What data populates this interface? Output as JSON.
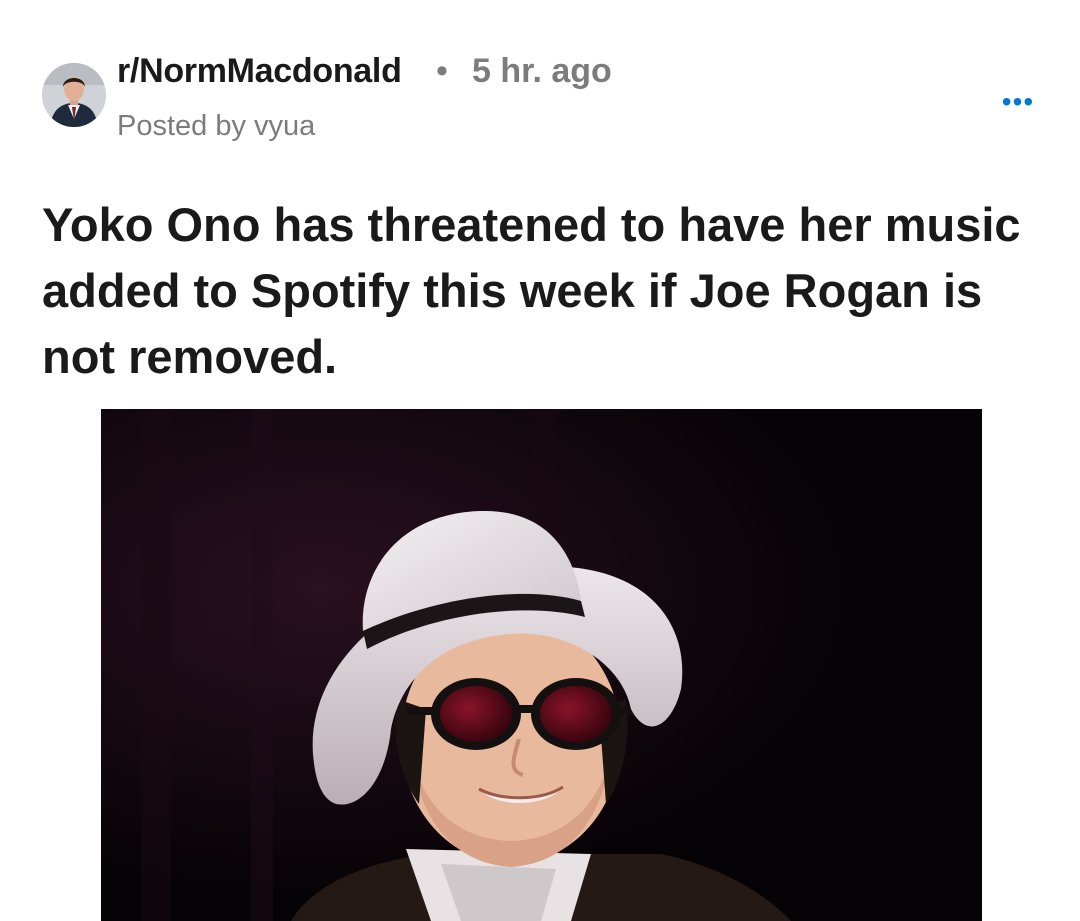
{
  "post": {
    "subreddit": "r/NormMacdonald",
    "separator": "•",
    "age": "5 hr. ago",
    "posted_by": "Posted by vyua",
    "more_label": "•••",
    "title": "Yoko Ono has threatened to have her music added to Spotify this week if Joe Rogan is not removed."
  },
  "colors": {
    "link_blue": "#0079d3",
    "meta_gray": "#7c7c7c",
    "text_dark": "#1a1a1b"
  }
}
